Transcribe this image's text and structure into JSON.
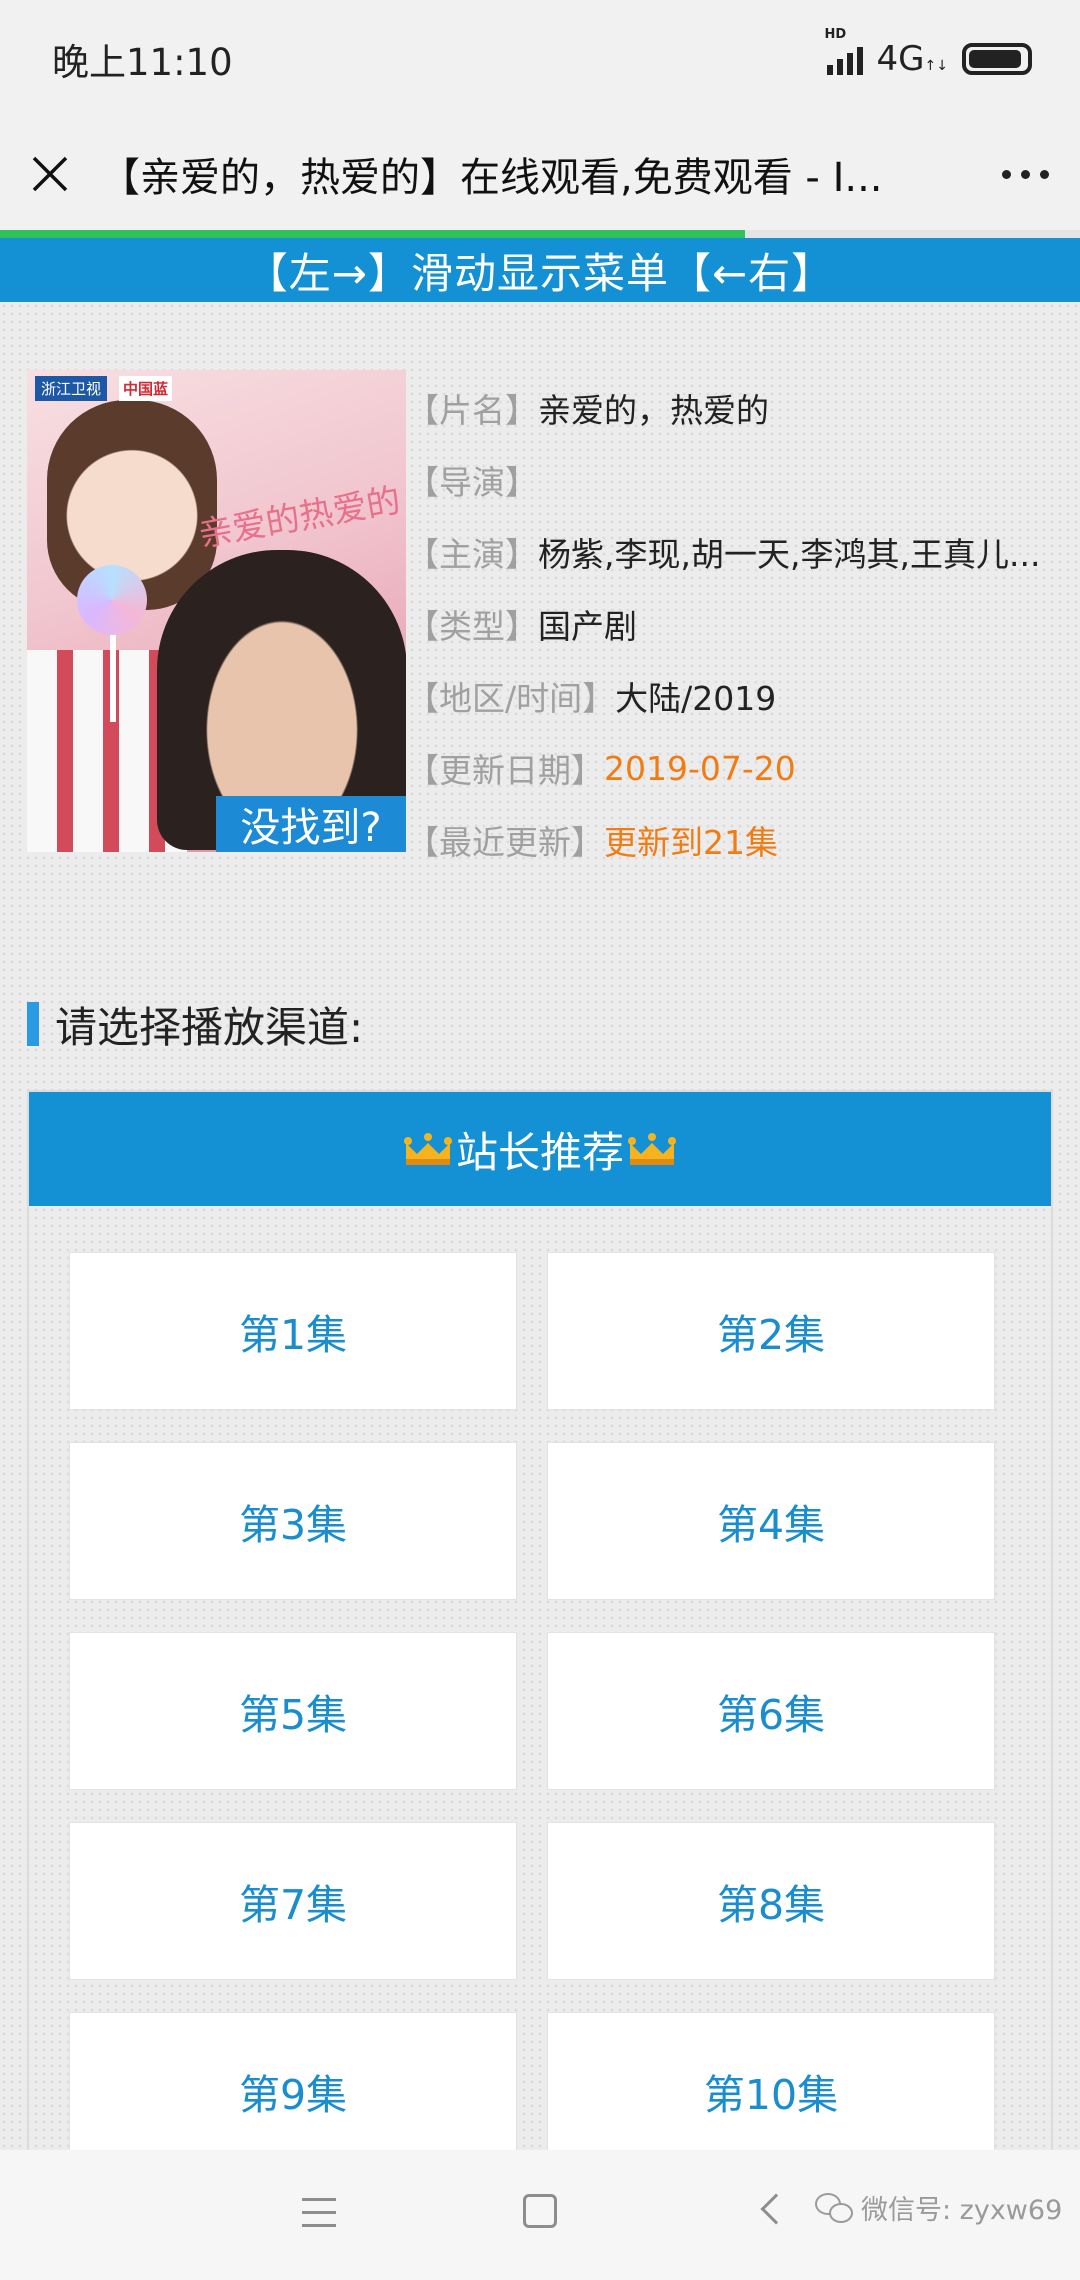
{
  "status_bar": {
    "time": "晚上11:10",
    "signal_label": "HD",
    "network": "4G",
    "network_sub": "↑↓"
  },
  "title_bar": {
    "title": "【亲爱的，热爱的】在线观看,免费观看 - I...",
    "close_icon": "close-icon",
    "more_icon": "more-icon",
    "load_progress": 0.69
  },
  "menu_banner": {
    "text": "【左→】滑动显示菜单【←右】"
  },
  "movie": {
    "poster_logo_tv": "浙江卫视",
    "poster_logo_blue": "中国蓝",
    "poster_title": "亲爱的热爱的",
    "not_found_tag": "没找到?",
    "info": [
      {
        "label": "【片名】",
        "value": "亲爱的，热爱的",
        "highlight": false
      },
      {
        "label": "【导演】",
        "value": "",
        "highlight": false
      },
      {
        "label": "【主演】",
        "value": "杨紫,李现,胡一天,李鸿其,王真儿...",
        "highlight": false
      },
      {
        "label": "【类型】",
        "value": "国产剧",
        "highlight": false
      },
      {
        "label": "【地区/时间】",
        "value": "大陆/2019",
        "highlight": false
      },
      {
        "label": "【更新日期】",
        "value": "2019-07-20",
        "highlight": true
      },
      {
        "label": "【最近更新】",
        "value": "更新到21集",
        "highlight": true
      }
    ]
  },
  "channels": {
    "heading": "请选择播放渠道:",
    "header_title": "站长推荐",
    "episodes": [
      "第1集",
      "第2集",
      "第3集",
      "第4集",
      "第5集",
      "第6集",
      "第7集",
      "第8集",
      "第9集",
      "第10集"
    ]
  },
  "nav_bar": {
    "watermark": "微信号: zyxw69"
  },
  "colors": {
    "accent_blue": "#1391d4",
    "episode_text": "#1a8dcf",
    "highlight_orange": "#f07c14",
    "progress_green": "#2fc25b"
  }
}
